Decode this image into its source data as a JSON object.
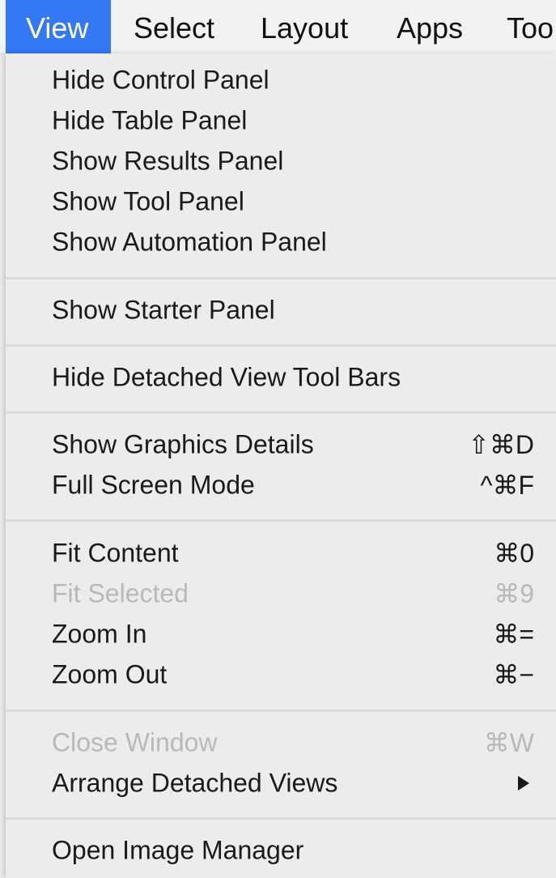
{
  "menubar": {
    "items": [
      {
        "label": "View",
        "active": true
      },
      {
        "label": "Select"
      },
      {
        "label": "Layout"
      },
      {
        "label": "Apps"
      },
      {
        "label": "Too"
      }
    ]
  },
  "menu": {
    "groups": [
      [
        {
          "label": "Hide Control Panel"
        },
        {
          "label": "Hide Table Panel"
        },
        {
          "label": "Show Results Panel"
        },
        {
          "label": "Show Tool Panel"
        },
        {
          "label": "Show Automation Panel"
        }
      ],
      [
        {
          "label": "Show Starter Panel"
        }
      ],
      [
        {
          "label": "Hide Detached View Tool Bars"
        }
      ],
      [
        {
          "label": "Show Graphics Details",
          "shortcut": "⇧⌘D"
        },
        {
          "label": "Full Screen Mode",
          "shortcut": "^⌘F"
        }
      ],
      [
        {
          "label": "Fit Content",
          "shortcut": "⌘0"
        },
        {
          "label": "Fit Selected",
          "shortcut": "⌘9",
          "disabled": true
        },
        {
          "label": "Zoom In",
          "shortcut": "⌘="
        },
        {
          "label": "Zoom Out",
          "shortcut": "⌘−"
        }
      ],
      [
        {
          "label": "Close Window",
          "shortcut": "⌘W",
          "disabled": true
        },
        {
          "label": "Arrange Detached Views",
          "submenu": true
        }
      ],
      [
        {
          "label": "Open Image Manager"
        }
      ]
    ]
  },
  "colors": {
    "accent": "#3478f6",
    "menu_bg": "#ececec",
    "text": "#1a1a1a",
    "disabled_text": "#b9b9b9",
    "separator": "#d9d9d9"
  }
}
